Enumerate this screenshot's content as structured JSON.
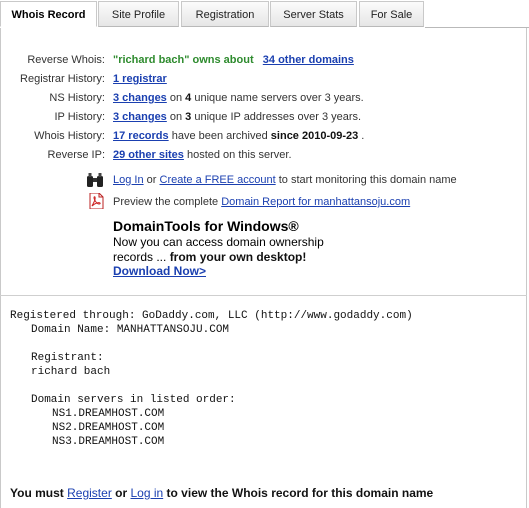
{
  "tabs": [
    {
      "label": "Whois Record",
      "active": true
    },
    {
      "label": "Site Profile",
      "active": false
    },
    {
      "label": "Registration",
      "active": false
    },
    {
      "label": "Server Stats",
      "active": false
    },
    {
      "label": "For Sale",
      "active": false
    }
  ],
  "info": {
    "reverse_whois": {
      "label": "Reverse Whois:",
      "owner_text": "\"richard bach\" owns about",
      "link": "34 other domains"
    },
    "registrar_history": {
      "label": "Registrar History:",
      "link": "1 registrar"
    },
    "ns_history": {
      "label": "NS History:",
      "link": "3 changes",
      "pre": " on ",
      "count": "4",
      "post": " unique name servers over 3 years."
    },
    "ip_history": {
      "label": "IP History:",
      "link": "3 changes",
      "pre": " on ",
      "count": "3",
      "post": " unique IP addresses over 3 years."
    },
    "whois_history": {
      "label": "Whois History:",
      "link": "17 records",
      "pre": " have been archived ",
      "since": "since 2010-09-23",
      "post": " ."
    },
    "reverse_ip": {
      "label": "Reverse IP:",
      "link": "29 other sites",
      "post": " hosted on this server."
    }
  },
  "monitor": {
    "login": "Log In",
    "or": " or ",
    "create": "Create a FREE account",
    "post": " to start monitoring this domain name"
  },
  "preview": {
    "pre": "Preview the complete ",
    "link": "Domain Report for manhattansoju.com"
  },
  "promo": {
    "title": "DomainTools for Windows®",
    "line1": "Now you can access domain ownership",
    "line2_pre": "records ... ",
    "line2_bold": "from your own desktop!",
    "download": "Download Now>"
  },
  "whois_text": {
    "line1": "Registered through: GoDaddy.com, LLC (http://www.godaddy.com)",
    "line2": "Domain Name: MANHATTANSOJU.COM",
    "line3": "Registrant:",
    "line4": "richard bach",
    "line5": "Domain servers in listed order:",
    "ns1": "NS1.DREAMHOST.COM",
    "ns2": "NS2.DREAMHOST.COM",
    "ns3": "NS3.DREAMHOST.COM"
  },
  "bottom": {
    "pre": "You must ",
    "register": "Register",
    "or": " or ",
    "login": "Log in",
    "post": " to view the Whois record for this domain name"
  }
}
